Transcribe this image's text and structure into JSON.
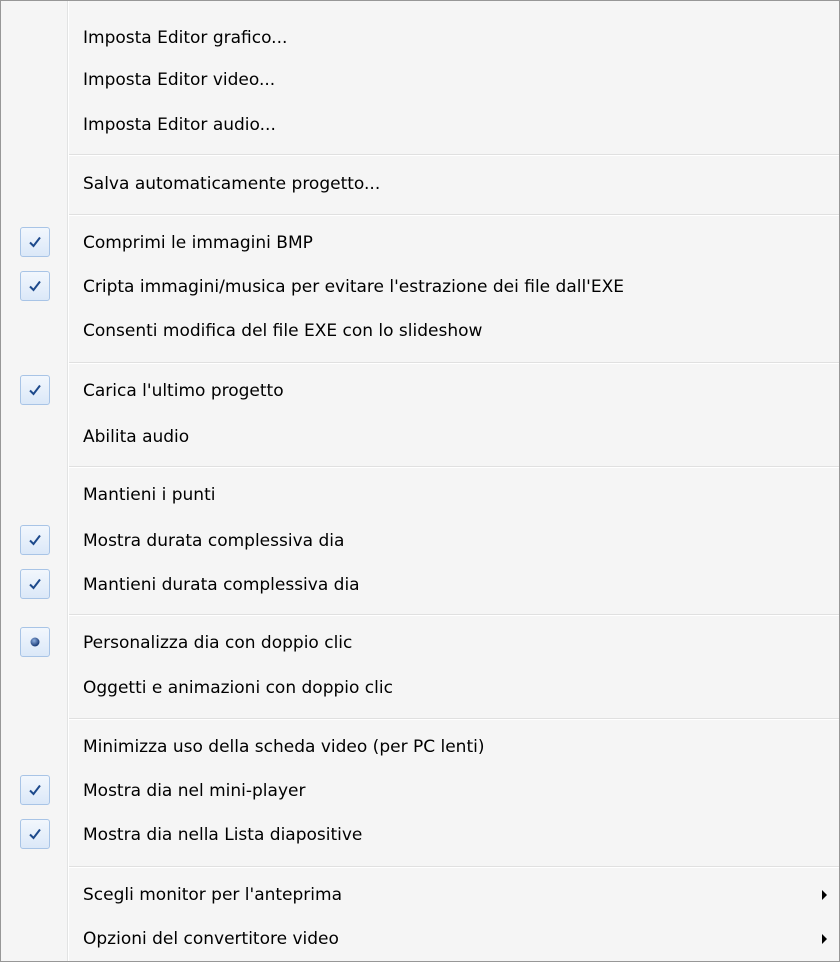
{
  "menu": {
    "items": [
      {
        "label": "Imposta Editor grafico...",
        "mark": "none"
      },
      {
        "label": "Imposta Editor video...",
        "mark": "none"
      },
      {
        "label": "Imposta Editor audio...",
        "mark": "none"
      },
      {
        "label": "Salva automaticamente progetto...",
        "mark": "none"
      },
      {
        "label": "Comprimi le immagini BMP",
        "mark": "check"
      },
      {
        "label": "Cripta immagini/musica per evitare l'estrazione dei file dall'EXE",
        "mark": "check"
      },
      {
        "label": "Consenti modifica del file EXE con lo slideshow",
        "mark": "none"
      },
      {
        "label": "Carica l'ultimo progetto",
        "mark": "check"
      },
      {
        "label": "Abilita audio",
        "mark": "none"
      },
      {
        "label": "Mantieni i punti",
        "mark": "none"
      },
      {
        "label": "Mostra durata complessiva dia",
        "mark": "check"
      },
      {
        "label": "Mantieni durata complessiva dia",
        "mark": "check"
      },
      {
        "label": "Personalizza dia con doppio clic",
        "mark": "radio"
      },
      {
        "label": "Oggetti e animazioni con doppio clic",
        "mark": "none"
      },
      {
        "label": "Minimizza uso della scheda video (per PC lenti)",
        "mark": "none"
      },
      {
        "label": "Mostra dia nel mini-player",
        "mark": "check"
      },
      {
        "label": "Mostra dia nella Lista diapositive",
        "mark": "check"
      },
      {
        "label": "Scegli monitor per l'anteprima",
        "mark": "none",
        "submenu": true
      },
      {
        "label": "Opzioni del convertitore video",
        "mark": "none",
        "submenu": true
      }
    ]
  },
  "icons": {
    "check": "check-mark-icon",
    "radio": "radio-dot-icon",
    "submenu": "submenu-arrow-icon"
  },
  "colors": {
    "menu_background": "#f5f5f5",
    "check_color": "#1e4a8c",
    "border": "#979797"
  }
}
